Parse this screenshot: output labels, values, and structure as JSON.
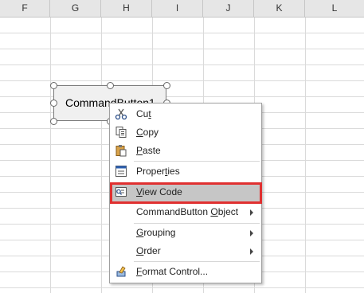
{
  "columns": [
    "F",
    "G",
    "H",
    "I",
    "J",
    "K",
    "L"
  ],
  "command_button": {
    "label": "CommandButton1"
  },
  "context_menu": {
    "items": [
      {
        "pre": "Cu",
        "key": "t",
        "post": "",
        "icon": "scissors-icon"
      },
      {
        "pre": "",
        "key": "C",
        "post": "opy",
        "icon": "copy-icon"
      },
      {
        "pre": "",
        "key": "P",
        "post": "aste",
        "icon": "paste-icon"
      },
      {
        "pre": "Proper",
        "key": "t",
        "post": "ies",
        "icon": "properties-icon"
      },
      {
        "pre": "",
        "key": "V",
        "post": "iew Code",
        "icon": "view-code-icon"
      },
      {
        "pre": "CommandButton ",
        "key": "O",
        "post": "bject",
        "submenu": true
      },
      {
        "pre": "",
        "key": "G",
        "post": "rouping",
        "submenu": true
      },
      {
        "pre": "",
        "key": "O",
        "post": "rder",
        "submenu": true
      },
      {
        "pre": "",
        "key": "F",
        "post": "ormat Control...",
        "icon": "format-control-icon"
      }
    ]
  },
  "colors": {
    "highlight_border": "#e03030",
    "selected_item_bg": "#c6c6c6"
  }
}
